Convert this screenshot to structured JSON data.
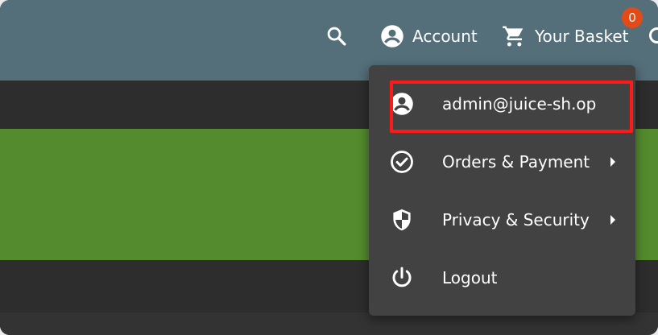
{
  "toolbar": {
    "search_icon": "search-icon",
    "account_label": "Account",
    "basket_label": "Your Basket",
    "basket_count": "0"
  },
  "account_menu": {
    "items": [
      {
        "label": "admin@juice-sh.op",
        "icon": "account-circle-icon",
        "has_submenu": false,
        "highlighted": true
      },
      {
        "label": "Orders & Payment",
        "icon": "check-circle-icon",
        "has_submenu": true
      },
      {
        "label": "Privacy & Security",
        "icon": "shield-icon",
        "has_submenu": true
      },
      {
        "label": "Logout",
        "icon": "power-icon",
        "has_submenu": false
      }
    ]
  },
  "colors": {
    "toolbar": "#546e7a",
    "menu_background": "#424242",
    "banner": "#548b2e",
    "badge": "#e34a18",
    "highlight_box": "#ff1a1a"
  }
}
